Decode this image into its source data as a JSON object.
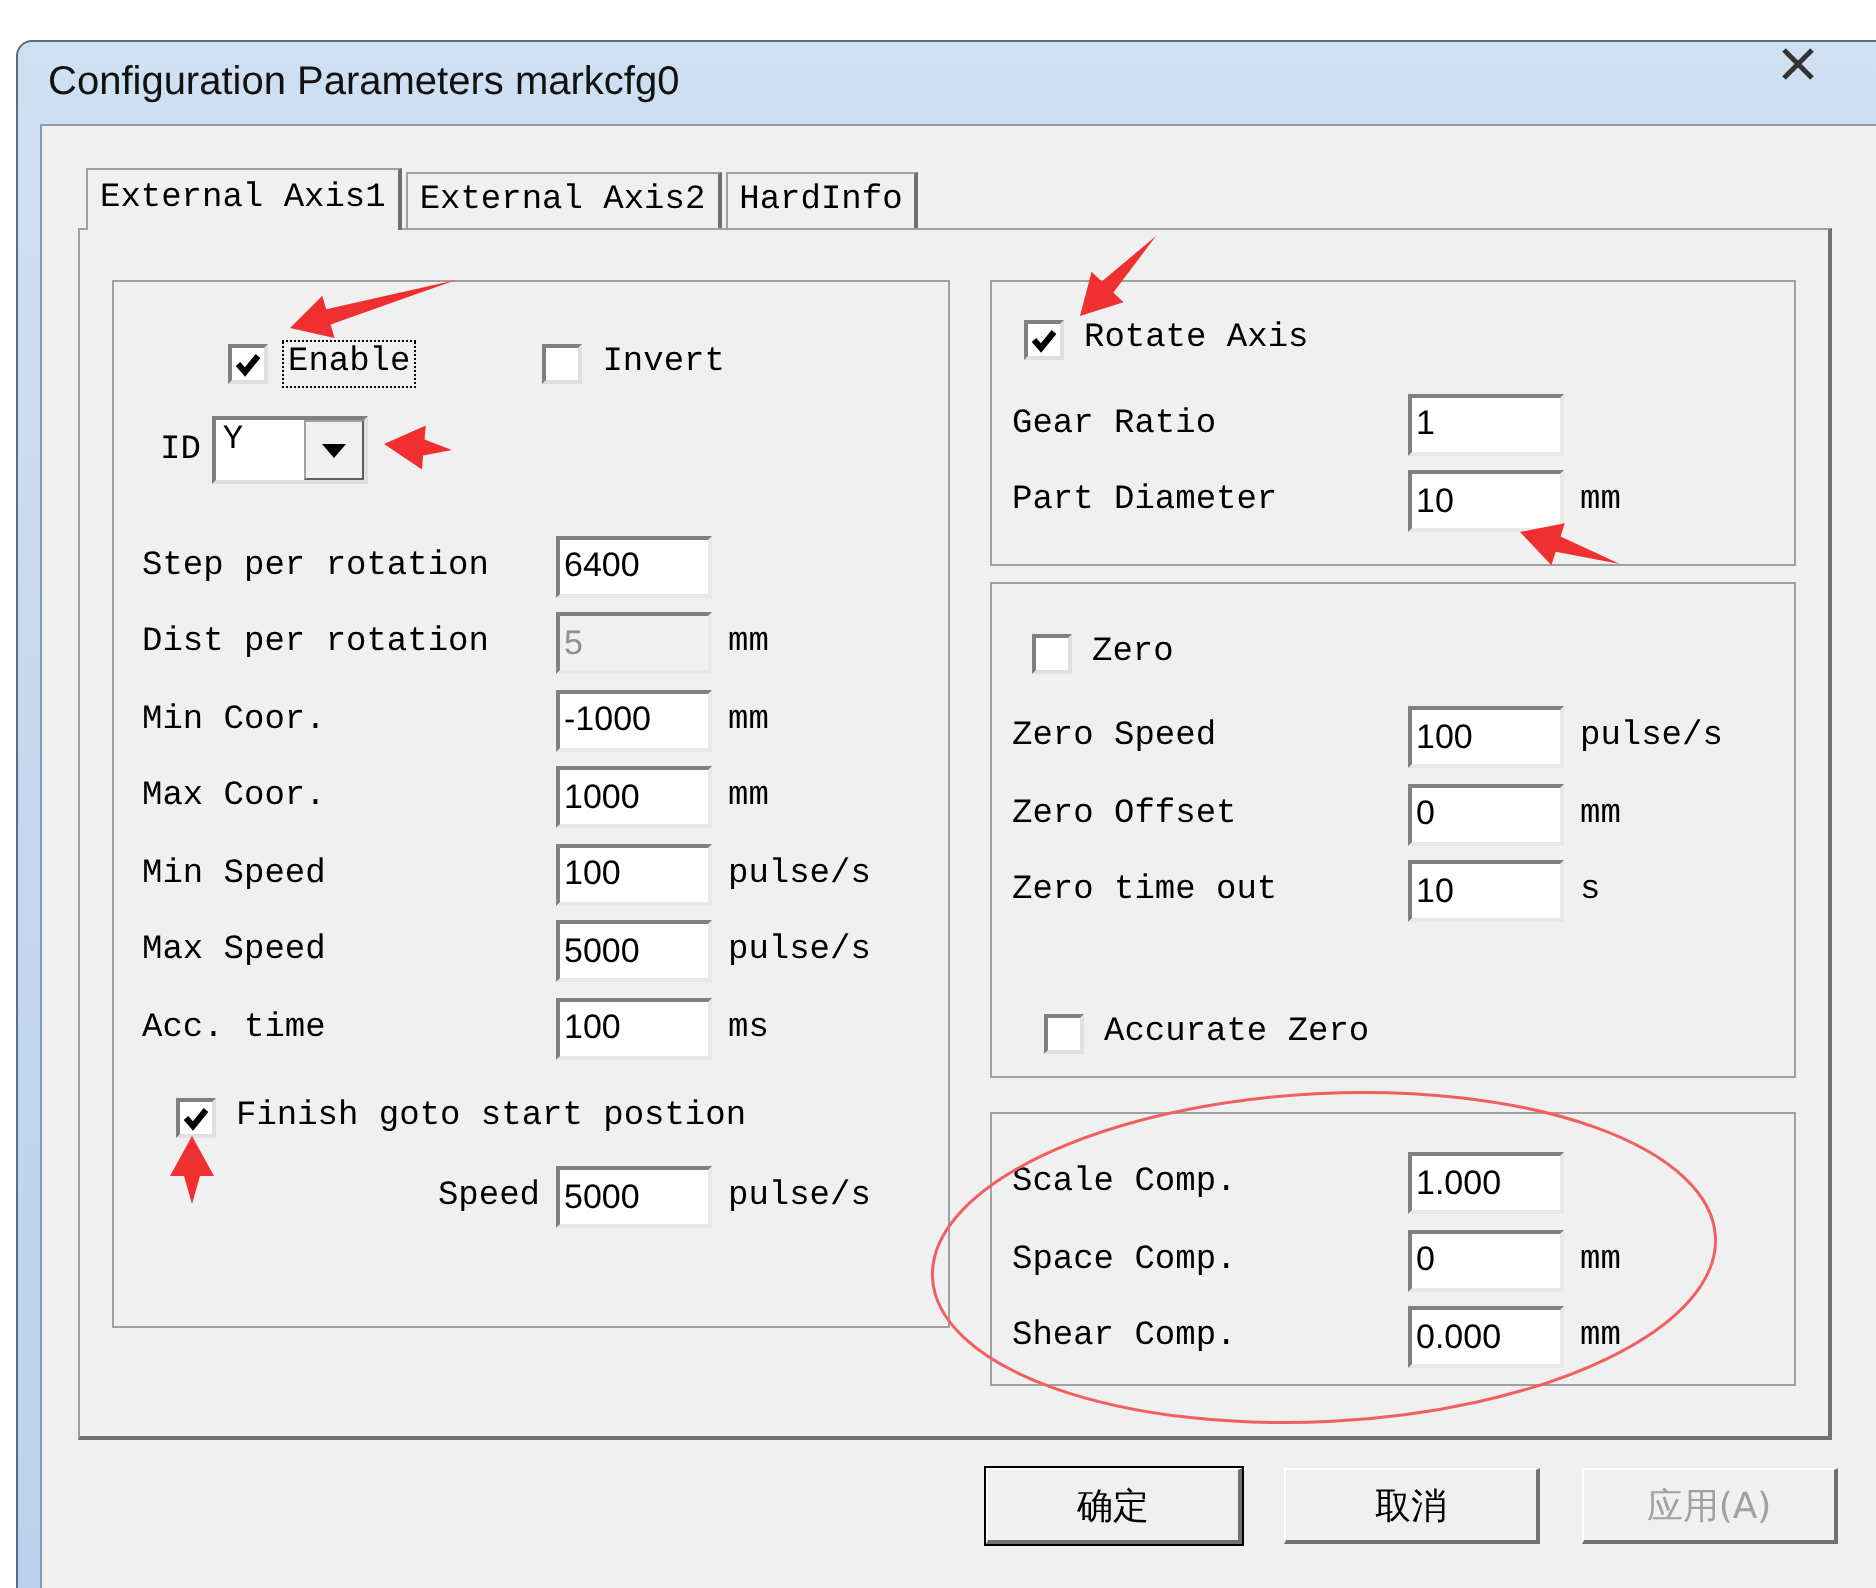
{
  "window": {
    "title": "Configuration Parameters markcfg0"
  },
  "tabs": [
    {
      "label": "External Axis1",
      "selected": true
    },
    {
      "label": "External Axis2",
      "selected": false
    },
    {
      "label": "HardInfo",
      "selected": false
    }
  ],
  "axis_group": {
    "enable": {
      "label": "Enable",
      "checked": true,
      "focused": true
    },
    "invert": {
      "label": "Invert",
      "checked": false,
      "focused": false
    },
    "id": {
      "label": "ID",
      "value": "Y"
    },
    "fields": [
      {
        "label": "Step per rotation",
        "value": "6400",
        "disabled": false
      },
      {
        "label": "Dist per rotation",
        "value": "5",
        "unit": "mm",
        "disabled": true
      },
      {
        "label": "Min Coor.",
        "value": "-1000",
        "unit": "mm",
        "disabled": false
      },
      {
        "label": "Max Coor.",
        "value": "1000",
        "unit": "mm",
        "disabled": false
      },
      {
        "label": "Min Speed",
        "value": "100",
        "unit": "pulse/s",
        "disabled": false
      },
      {
        "label": "Max Speed",
        "value": "5000",
        "unit": "pulse/s",
        "disabled": false
      },
      {
        "label": "Acc. time",
        "value": "100",
        "unit": "ms",
        "disabled": false
      }
    ],
    "finish_goto_start": {
      "label": "Finish goto start postion",
      "checked": true,
      "focused": false
    },
    "speed": {
      "label": "Speed",
      "value": "5000",
      "unit": "pulse/s",
      "disabled": false
    }
  },
  "rotate_group": {
    "rotate_axis": {
      "label": "Rotate Axis",
      "checked": true,
      "focused": false
    },
    "fields": [
      {
        "label": "Gear Ratio",
        "value": "1",
        "disabled": false
      },
      {
        "label": "Part Diameter",
        "value": "10",
        "unit": "mm",
        "disabled": false
      }
    ]
  },
  "zero_group": {
    "zero": {
      "label": "Zero",
      "checked": false,
      "focused": false
    },
    "fields": [
      {
        "label": "Zero Speed",
        "value": "100",
        "unit": "pulse/s",
        "disabled": false
      },
      {
        "label": "Zero Offset",
        "value": "0",
        "unit": "mm",
        "disabled": false
      },
      {
        "label": "Zero time out",
        "value": "10",
        "unit": "s",
        "disabled": false
      }
    ],
    "accurate_zero": {
      "label": "Accurate Zero",
      "checked": false,
      "focused": false
    }
  },
  "compensation_group": {
    "fields": [
      {
        "label": "Scale Comp.",
        "value": "1.000",
        "disabled": false
      },
      {
        "label": "Space Comp.",
        "value": "0",
        "unit": "mm",
        "disabled": false
      },
      {
        "label": "Shear Comp.",
        "value": "0.000",
        "unit": "mm",
        "disabled": false
      }
    ]
  },
  "buttons": [
    {
      "label": "确定",
      "default": true,
      "disabled": false
    },
    {
      "label": "取消",
      "default": false,
      "disabled": false
    },
    {
      "label": "应用(A)",
      "default": false,
      "disabled": true
    }
  ]
}
